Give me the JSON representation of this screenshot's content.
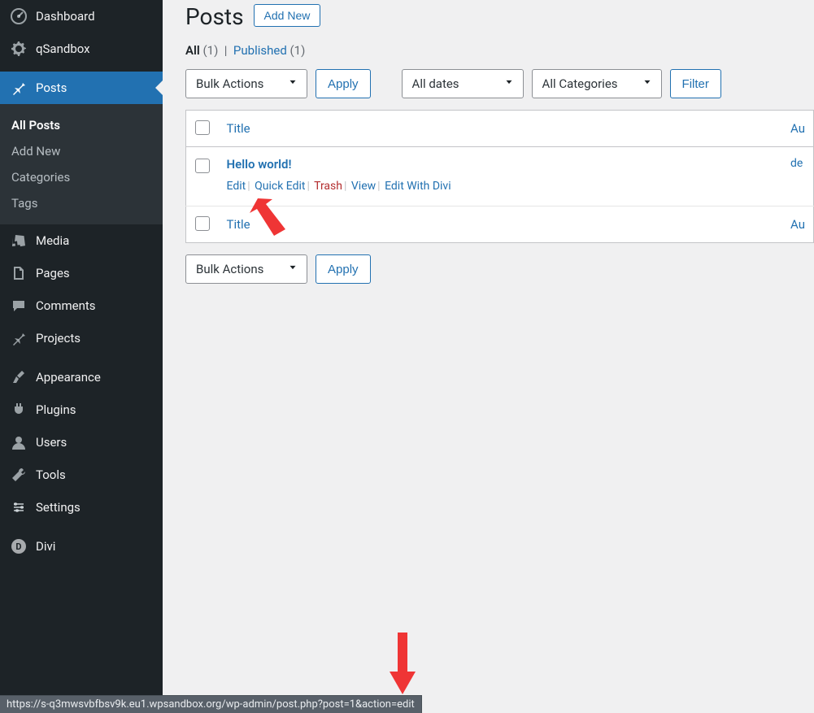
{
  "sidebar": {
    "top": [
      {
        "icon": "dashboard",
        "label": "Dashboard"
      },
      {
        "icon": "gear",
        "label": "qSandbox"
      }
    ],
    "posts": {
      "icon": "pin",
      "label": "Posts",
      "submenu": [
        {
          "label": "All Posts",
          "current": true
        },
        {
          "label": "Add New"
        },
        {
          "label": "Categories"
        },
        {
          "label": "Tags"
        }
      ]
    },
    "middle": [
      {
        "icon": "media",
        "label": "Media"
      },
      {
        "icon": "pages",
        "label": "Pages"
      },
      {
        "icon": "comments",
        "label": "Comments"
      },
      {
        "icon": "projects",
        "label": "Projects"
      }
    ],
    "bottom": [
      {
        "icon": "appearance",
        "label": "Appearance"
      },
      {
        "icon": "plugins",
        "label": "Plugins"
      },
      {
        "icon": "users",
        "label": "Users"
      },
      {
        "icon": "tools",
        "label": "Tools"
      },
      {
        "icon": "settings",
        "label": "Settings"
      }
    ],
    "divi": {
      "icon": "divi",
      "label": "Divi"
    }
  },
  "page": {
    "title": "Posts",
    "add_new": "Add New"
  },
  "filters_row": {
    "all_label": "All",
    "all_count": "(1)",
    "sep": "|",
    "published_label": "Published",
    "published_count": "(1)"
  },
  "controls": {
    "bulk_actions": "Bulk Actions",
    "apply": "Apply",
    "all_dates": "All dates",
    "all_categories": "All Categories",
    "filter": "Filter"
  },
  "table": {
    "header_title": "Title",
    "header_author": "Au",
    "footer_title": "Title",
    "footer_author": "Au",
    "rows": [
      {
        "title": "Hello world!",
        "author_cut": "de",
        "actions": {
          "edit": "Edit",
          "quick_edit": "Quick Edit",
          "trash": "Trash",
          "view": "View",
          "edit_divi": "Edit With Divi"
        }
      }
    ]
  },
  "statusbar": {
    "url": "https://s-q3mwsvbfbsv9k.eu1.wpsandbox.org/wp-admin/post.php?post=1&action=edit"
  }
}
